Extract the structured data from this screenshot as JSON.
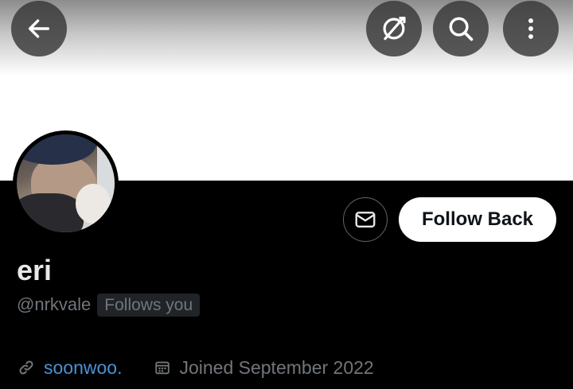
{
  "header": {
    "back_icon": "arrow-left-icon",
    "translate_icon": "translate-off-icon",
    "search_icon": "search-icon",
    "more_icon": "more-vertical-icon",
    "overlay_button_color": "#373737"
  },
  "profile": {
    "display_name": "eri",
    "handle": "@nrkvale",
    "follows_you_badge": "Follows you",
    "website_icon": "link-icon",
    "website": "soonwoo.",
    "joined_icon": "calendar-icon",
    "joined": "Joined September 2022"
  },
  "actions": {
    "message_icon": "envelope-icon",
    "follow_back_label": "Follow Back"
  },
  "colors": {
    "background": "#000000",
    "banner": "#ffffff",
    "link": "#4b91d6",
    "secondary_text": "#71767b",
    "primary_text": "#e7e9ea",
    "follow_button_bg": "#ffffff",
    "follow_button_text": "#0f1419"
  }
}
